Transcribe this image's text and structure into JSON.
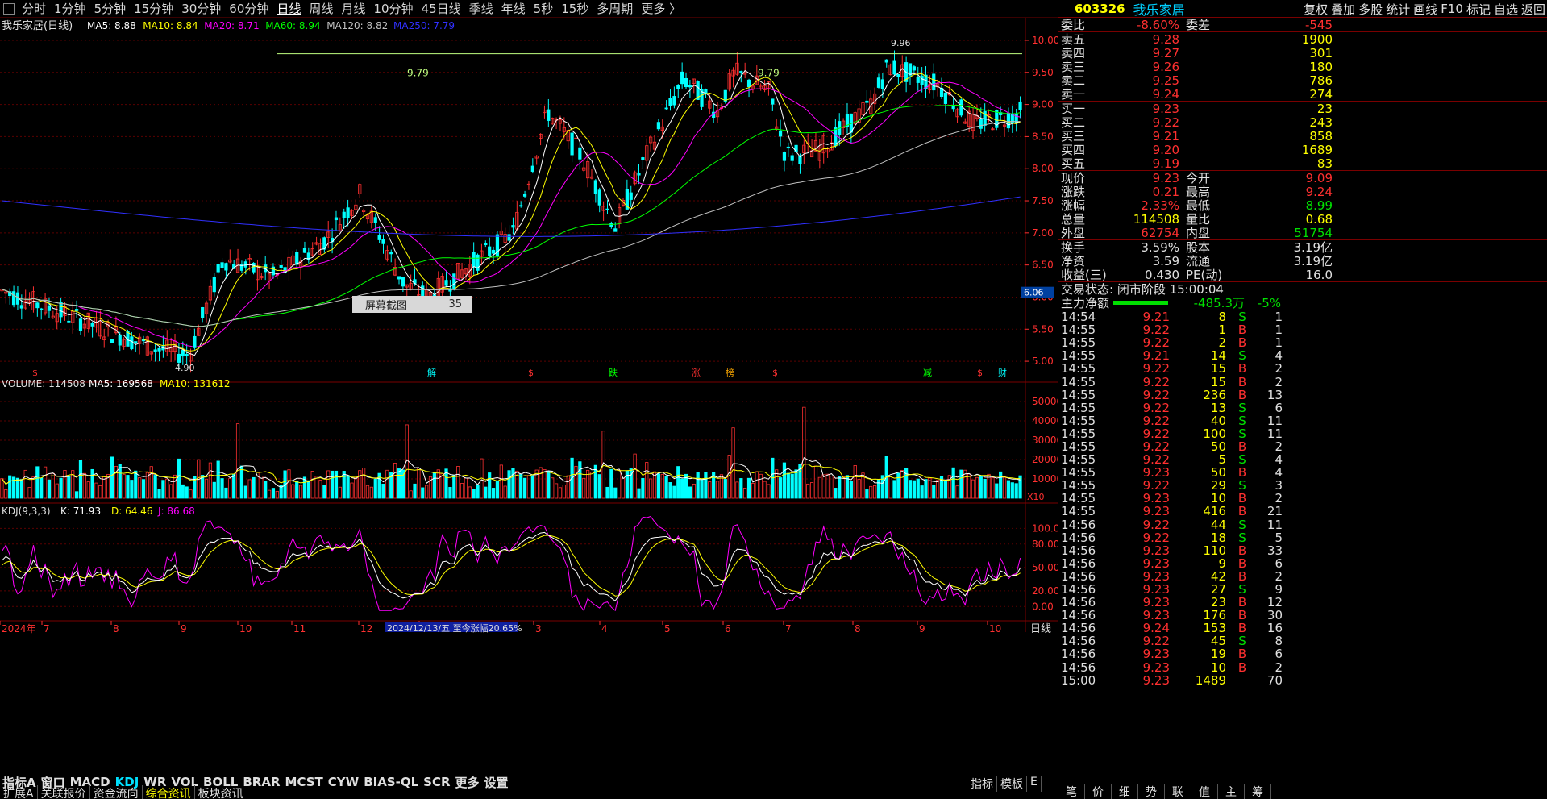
{
  "topbar": {
    "periods": [
      "分时",
      "1分钟",
      "5分钟",
      "15分钟",
      "30分钟",
      "60分钟",
      "日线",
      "周线",
      "月线",
      "10分钟",
      "45日线",
      "季线",
      "年线",
      "5秒",
      "15秒",
      "多周期",
      "更多 〉"
    ],
    "active_period": "日线",
    "right_items": [
      "复权",
      "叠加",
      "多股",
      "统计",
      "画线",
      "F10",
      "标记",
      "自选",
      "返回"
    ]
  },
  "main_chart": {
    "title": "我乐家居(日线)",
    "ma_legend": [
      {
        "label": "MA5: 8.88",
        "color": "#ffffff"
      },
      {
        "label": "MA10: 8.84",
        "color": "#ffff00"
      },
      {
        "label": "MA20: 8.71",
        "color": "#ff00ff"
      },
      {
        "label": "MA60: 8.94",
        "color": "#00ff00"
      },
      {
        "label": "MA120: 8.82",
        "color": "#c0c0c0"
      },
      {
        "label": "MA250: 7.79",
        "color": "#3030ff"
      }
    ],
    "price_axis": [
      "10.00",
      "9.50",
      "9.00",
      "8.50",
      "8.00",
      "7.50",
      "7.00",
      "6.50",
      "6.00",
      "5.50",
      "5.00"
    ],
    "price_range": [
      4.75,
      10.1
    ],
    "current_price_tag": "6.06",
    "high_label": "9.96",
    "low_label": "4.90",
    "line_labels": [
      "9.79",
      "9.79"
    ],
    "event_markers": [
      "$",
      "解",
      "$",
      "跌",
      "涨",
      "榜",
      "$",
      "减",
      "$",
      "财"
    ]
  },
  "volume_chart": {
    "title": "VOLUME: 114508",
    "ma5": "MA5: 169568",
    "ma10": "MA10: 131612",
    "axis": [
      "50000",
      "40000",
      "30000",
      "20000",
      "10000"
    ],
    "unit": "X10"
  },
  "kdj_chart": {
    "title": "KDJ(9,3,3)",
    "k": "K: 71.93",
    "d": "D: 64.46",
    "j": "J: 86.68",
    "axis": [
      "100.00",
      "80.00",
      "50.00",
      "20.00",
      "0.00"
    ]
  },
  "time_axis": {
    "labels": [
      "2024年",
      "7",
      "8",
      "9",
      "10",
      "11",
      "12",
      "2",
      "3",
      "4",
      "5",
      "6",
      "7",
      "8",
      "9",
      "10"
    ],
    "highlight": "2024/12/13/五  至今涨幅20.65%",
    "period": "日线"
  },
  "overlay": {
    "label": "屏幕截图",
    "count": "35"
  },
  "bottom_tabs": {
    "row1": [
      "指标A",
      "窗口",
      "MACD",
      "KDJ",
      "WR",
      "VOL",
      "BOLL",
      "BRAR",
      "MCST",
      "CYW",
      "BIAS-QL",
      "SCR",
      "更多",
      "设置"
    ],
    "active": "KDJ",
    "row2": [
      "扩展A",
      "关联报价",
      "资金流向",
      "综合资讯",
      "板块资讯"
    ],
    "active2": "综合资讯",
    "right": [
      "指标",
      "模板",
      "E"
    ]
  },
  "quote_panel": {
    "code": "603326",
    "name": "我乐家居",
    "weibi": {
      "label": "委比",
      "value": "-8.60%",
      "label2": "委差",
      "value2": "-545"
    },
    "sell": [
      {
        "label": "卖五",
        "price": "9.28",
        "vol": "1900"
      },
      {
        "label": "卖四",
        "price": "9.27",
        "vol": "301"
      },
      {
        "label": "卖三",
        "price": "9.26",
        "vol": "180"
      },
      {
        "label": "卖二",
        "price": "9.25",
        "vol": "786"
      },
      {
        "label": "卖一",
        "price": "9.24",
        "vol": "274"
      }
    ],
    "buy": [
      {
        "label": "买一",
        "price": "9.23",
        "vol": "23"
      },
      {
        "label": "买二",
        "price": "9.22",
        "vol": "243"
      },
      {
        "label": "买三",
        "price": "9.21",
        "vol": "858"
      },
      {
        "label": "买四",
        "price": "9.20",
        "vol": "1689"
      },
      {
        "label": "买五",
        "price": "9.19",
        "vol": "83"
      }
    ],
    "stats": [
      {
        "l1": "现价",
        "v1": "9.23",
        "c1": "red",
        "l2": "今开",
        "v2": "9.09",
        "c2": "red"
      },
      {
        "l1": "涨跌",
        "v1": "0.21",
        "c1": "red",
        "l2": "最高",
        "v2": "9.24",
        "c2": "red"
      },
      {
        "l1": "涨幅",
        "v1": "2.33%",
        "c1": "red",
        "l2": "最低",
        "v2": "8.99",
        "c2": "green"
      },
      {
        "l1": "总量",
        "v1": "114508",
        "c1": "yellow",
        "l2": "量比",
        "v2": "0.68",
        "c2": "yellow"
      },
      {
        "l1": "外盘",
        "v1": "62754",
        "c1": "red",
        "l2": "内盘",
        "v2": "51754",
        "c2": "green"
      }
    ],
    "stats2": [
      {
        "l1": "换手",
        "v1": "3.59%",
        "l2": "股本",
        "v2": "3.19亿"
      },
      {
        "l1": "净资",
        "v1": "3.59",
        "l2": "流通",
        "v2": "3.19亿"
      },
      {
        "l1": "收益(三)",
        "v1": "0.430",
        "l2": "PE(动)",
        "v2": "16.0"
      }
    ],
    "trade_status": "交易状态: 闭市阶段 15:00:04",
    "main_net": {
      "label": "主力净额",
      "value": "-485.3万",
      "pct": "-5%"
    },
    "ticks": [
      [
        "14:54",
        "9.21",
        "8",
        "S",
        "1"
      ],
      [
        "14:55",
        "9.22",
        "1",
        "B",
        "1"
      ],
      [
        "14:55",
        "9.22",
        "2",
        "B",
        "1"
      ],
      [
        "14:55",
        "9.21",
        "14",
        "S",
        "4"
      ],
      [
        "14:55",
        "9.22",
        "15",
        "B",
        "2"
      ],
      [
        "14:55",
        "9.22",
        "15",
        "B",
        "2"
      ],
      [
        "14:55",
        "9.22",
        "236",
        "B",
        "13"
      ],
      [
        "14:55",
        "9.22",
        "13",
        "S",
        "6"
      ],
      [
        "14:55",
        "9.22",
        "40",
        "S",
        "11"
      ],
      [
        "14:55",
        "9.22",
        "100",
        "S",
        "11"
      ],
      [
        "14:55",
        "9.22",
        "50",
        "B",
        "2"
      ],
      [
        "14:55",
        "9.22",
        "5",
        "S",
        "4"
      ],
      [
        "14:55",
        "9.23",
        "50",
        "B",
        "4"
      ],
      [
        "14:55",
        "9.22",
        "29",
        "S",
        "3"
      ],
      [
        "14:55",
        "9.23",
        "10",
        "B",
        "2"
      ],
      [
        "14:55",
        "9.23",
        "416",
        "B",
        "21"
      ],
      [
        "14:56",
        "9.22",
        "44",
        "S",
        "11"
      ],
      [
        "14:56",
        "9.22",
        "18",
        "S",
        "5"
      ],
      [
        "14:56",
        "9.23",
        "110",
        "B",
        "33"
      ],
      [
        "14:56",
        "9.23",
        "9",
        "B",
        "6"
      ],
      [
        "14:56",
        "9.23",
        "42",
        "B",
        "2"
      ],
      [
        "14:56",
        "9.23",
        "27",
        "S",
        "9"
      ],
      [
        "14:56",
        "9.23",
        "23",
        "B",
        "12"
      ],
      [
        "14:56",
        "9.23",
        "176",
        "B",
        "30"
      ],
      [
        "14:56",
        "9.24",
        "153",
        "B",
        "16"
      ],
      [
        "14:56",
        "9.22",
        "45",
        "S",
        "8"
      ],
      [
        "14:56",
        "9.23",
        "19",
        "B",
        "6"
      ],
      [
        "14:56",
        "9.23",
        "10",
        "B",
        "2"
      ],
      [
        "15:00",
        "9.23",
        "1489",
        "",
        "70"
      ]
    ],
    "bottom_tabs": [
      "笔",
      "价",
      "细",
      "势",
      "联",
      "值",
      "主",
      "筹"
    ]
  },
  "colors": {
    "up": "#ff3030",
    "down": "#00ffff",
    "grid": "#7a0000",
    "axis": "#ff3030"
  }
}
